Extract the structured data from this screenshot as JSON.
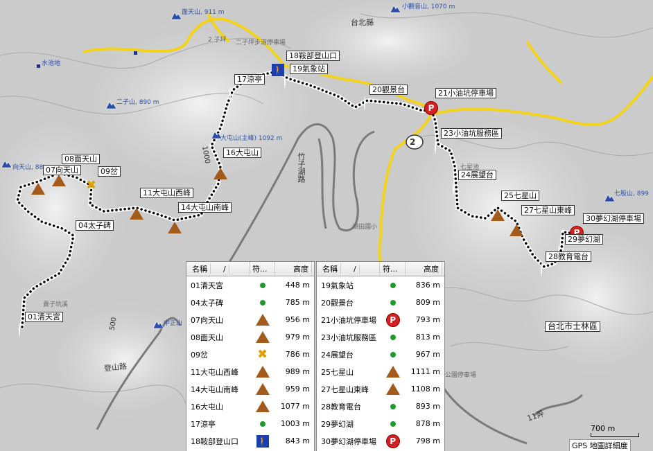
{
  "map_labels": {
    "county": "台北縣",
    "district": "台北市士林區",
    "road_lower": "登山路",
    "road_right": "竹子湖路",
    "lane": "11弄",
    "scale_text": "700 m",
    "detail_label": "GPS 地圖詳細度",
    "route_number": "2",
    "contour_1000": "1000",
    "contour_500": "500"
  },
  "pois": [
    {
      "text": "大屯山(主峰) 1092 m",
      "color": "blue"
    },
    {
      "text": "2 子坪",
      "color": "gray"
    },
    {
      "text": "二子坪步道停車場",
      "color": "gray"
    },
    {
      "text": "水池地",
      "color": "blue"
    },
    {
      "text": "二子山, 890 m",
      "color": "blue"
    },
    {
      "text": "向天山, 88",
      "color": "blue"
    },
    {
      "text": "面天山, 911 m",
      "color": "blue"
    },
    {
      "text": "小觀音山, 1070 m",
      "color": "blue"
    },
    {
      "text": "中正山",
      "color": "blue"
    },
    {
      "text": "七股山, 899",
      "color": "blue"
    },
    {
      "text": "七星池",
      "color": "gray"
    },
    {
      "text": "湖田國小",
      "color": "gray"
    },
    {
      "text": "貴子坑溪",
      "color": "gray"
    },
    {
      "text": "公園停車場",
      "color": "gray"
    }
  ],
  "waypoint_labels": [
    {
      "id": "01",
      "text": "01清天宮"
    },
    {
      "id": "04",
      "text": "04太子碑"
    },
    {
      "id": "07",
      "text": "07向天山"
    },
    {
      "id": "08",
      "text": "08面天山"
    },
    {
      "id": "09",
      "text": "09岔"
    },
    {
      "id": "11",
      "text": "11大屯山西峰"
    },
    {
      "id": "14",
      "text": "14大屯山南峰"
    },
    {
      "id": "16",
      "text": "16大屯山"
    },
    {
      "id": "17",
      "text": "17涼亭"
    },
    {
      "id": "18",
      "text": "18鞍部登山口"
    },
    {
      "id": "19",
      "text": "19氣象站"
    },
    {
      "id": "20",
      "text": "20觀景台"
    },
    {
      "id": "21",
      "text": "21小油坑停車場"
    },
    {
      "id": "23",
      "text": "23小油坑服務區"
    },
    {
      "id": "24",
      "text": "24展望台"
    },
    {
      "id": "25",
      "text": "25七星山"
    },
    {
      "id": "27",
      "text": "27七星山東峰"
    },
    {
      "id": "28",
      "text": "28教育電台"
    },
    {
      "id": "29",
      "text": "29夢幻湖"
    },
    {
      "id": "30",
      "text": "30夢幻湖停車場"
    }
  ],
  "tables": {
    "headers": {
      "name": "名稱",
      "sort_arrow": "/",
      "symbol": "符...",
      "elevation": "高度"
    },
    "left": [
      {
        "name": "01清天宮",
        "sym": "dot",
        "elev": "448 m"
      },
      {
        "name": "04太子碑",
        "sym": "dot",
        "elev": "785 m"
      },
      {
        "name": "07向天山",
        "sym": "peak",
        "elev": "956 m"
      },
      {
        "name": "08面天山",
        "sym": "peak",
        "elev": "979 m"
      },
      {
        "name": "09岔",
        "sym": "x",
        "elev": "786 m"
      },
      {
        "name": "11大屯山西峰",
        "sym": "peak",
        "elev": "989 m"
      },
      {
        "name": "14大屯山南峰",
        "sym": "peak",
        "elev": "959 m"
      },
      {
        "name": "16大屯山",
        "sym": "peak",
        "elev": "1077 m"
      },
      {
        "name": "17涼亭",
        "sym": "dot",
        "elev": "1003 m"
      },
      {
        "name": "18鞍部登山口",
        "sym": "hiker",
        "elev": "843 m"
      }
    ],
    "right": [
      {
        "name": "19氣象站",
        "sym": "dot",
        "elev": "836 m"
      },
      {
        "name": "20觀景台",
        "sym": "dot",
        "elev": "809 m"
      },
      {
        "name": "21小油坑停車場",
        "sym": "park",
        "elev": "793 m"
      },
      {
        "name": "23小油坑服務區",
        "sym": "dot",
        "elev": "813 m"
      },
      {
        "name": "24展望台",
        "sym": "dot",
        "elev": "967 m"
      },
      {
        "name": "25七星山",
        "sym": "peak",
        "elev": "1111 m"
      },
      {
        "name": "27七星山東峰",
        "sym": "peak",
        "elev": "1108 m"
      },
      {
        "name": "28教育電台",
        "sym": "dot",
        "elev": "893 m"
      },
      {
        "name": "29夢幻湖",
        "sym": "dot",
        "elev": "878 m"
      },
      {
        "name": "30夢幻湖停車場",
        "sym": "park",
        "elev": "798 m"
      }
    ]
  },
  "colors": {
    "road": "#f2d21a",
    "track": "#000000",
    "waypoint": "#1e9a2b",
    "parking": "#d32020",
    "peak": "#a35b1c"
  }
}
